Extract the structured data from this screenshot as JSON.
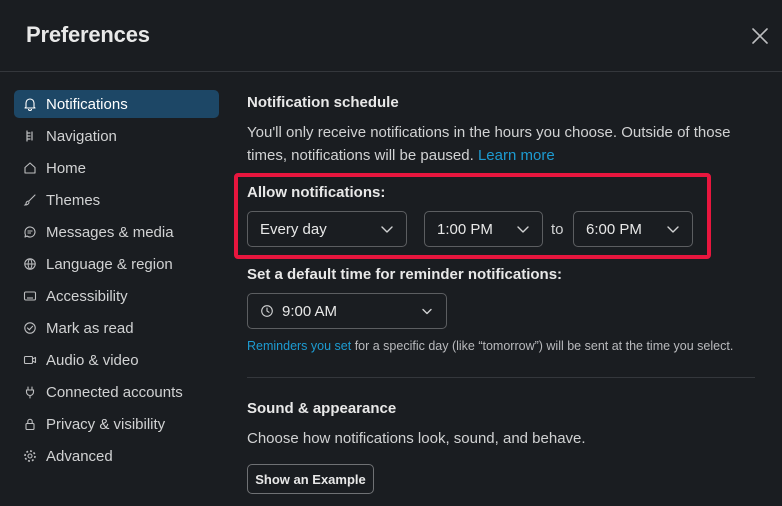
{
  "header": {
    "title": "Preferences"
  },
  "sidebar": {
    "items": [
      {
        "label": "Notifications",
        "icon": "bell-icon",
        "active": true
      },
      {
        "label": "Navigation",
        "icon": "navigation-icon"
      },
      {
        "label": "Home",
        "icon": "home-icon"
      },
      {
        "label": "Themes",
        "icon": "brush-icon"
      },
      {
        "label": "Messages & media",
        "icon": "message-icon"
      },
      {
        "label": "Language & region",
        "icon": "globe-icon"
      },
      {
        "label": "Accessibility",
        "icon": "keyboard-icon"
      },
      {
        "label": "Mark as read",
        "icon": "check-circle-icon"
      },
      {
        "label": "Audio & video",
        "icon": "video-icon"
      },
      {
        "label": "Connected accounts",
        "icon": "plug-icon"
      },
      {
        "label": "Privacy & visibility",
        "icon": "lock-icon"
      },
      {
        "label": "Advanced",
        "icon": "gear-icon"
      }
    ]
  },
  "schedule": {
    "title": "Notification schedule",
    "description": "You'll only receive notifications in the hours you choose. Outside of those times, notifications will be paused.",
    "learn_more": "Learn more",
    "allow_label": "Allow notifications:",
    "days_value": "Every day",
    "start_value": "1:00 PM",
    "to_text": "to",
    "end_value": "6:00 PM"
  },
  "reminder": {
    "label": "Set a default time for reminder notifications:",
    "value": "9:00 AM",
    "link": "Reminders you set",
    "note": " for a specific day (like “tomorrow”) will be sent at the time you select."
  },
  "sound": {
    "title": "Sound & appearance",
    "description": "Choose how notifications look, sound, and behave.",
    "example_button": "Show an Example"
  },
  "colors": {
    "background": "#1a1d21",
    "active_nav": "#1d4766",
    "link": "#1d9bd1",
    "highlight": "#e8163e"
  }
}
